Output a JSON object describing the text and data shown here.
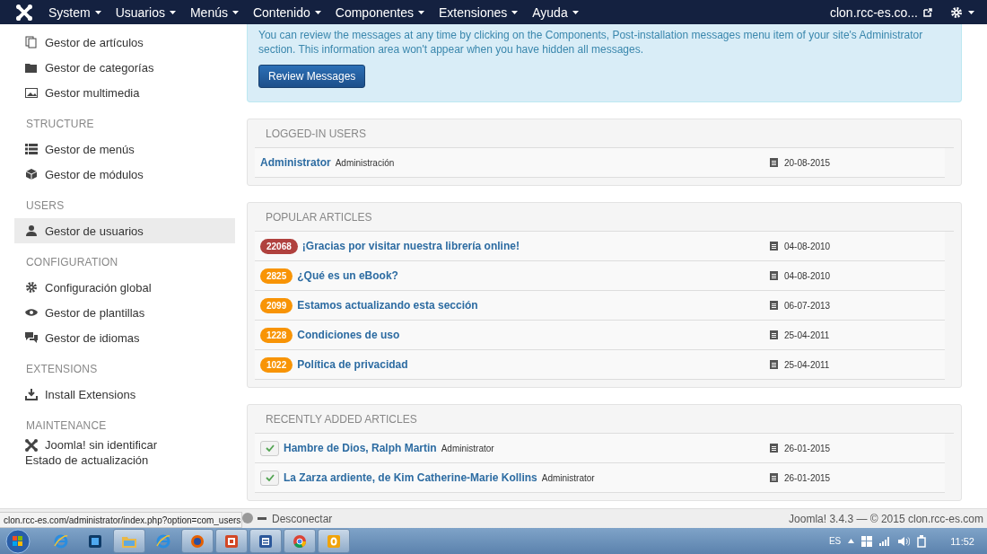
{
  "navbar": {
    "menus": [
      "System",
      "Usuarios",
      "Menús",
      "Contenido",
      "Componentes",
      "Extensiones",
      "Ayuda"
    ],
    "site": "clon.rcc-es.co..."
  },
  "sidebar": {
    "sections": [
      {
        "items": [
          {
            "label": "Gestor de artículos",
            "kind": "copy",
            "selected": false
          },
          {
            "label": "Gestor de categorías",
            "kind": "folder",
            "selected": false
          },
          {
            "label": "Gestor multimedia",
            "kind": "image",
            "selected": false
          }
        ]
      },
      {
        "heading": "STRUCTURE",
        "items": [
          {
            "label": "Gestor de menús",
            "kind": "list",
            "selected": false
          },
          {
            "label": "Gestor de módulos",
            "kind": "cube",
            "selected": false
          }
        ]
      },
      {
        "heading": "USERS",
        "items": [
          {
            "label": "Gestor de usuarios",
            "kind": "user",
            "selected": true
          }
        ]
      },
      {
        "heading": "CONFIGURATION",
        "items": [
          {
            "label": "Configuración global",
            "kind": "gear",
            "selected": false
          },
          {
            "label": "Gestor de plantillas",
            "kind": "eye",
            "selected": false
          },
          {
            "label": "Gestor de idiomas",
            "kind": "chat",
            "selected": false
          }
        ]
      },
      {
        "heading": "EXTENSIONS",
        "items": [
          {
            "label": "Install Extensions",
            "kind": "download",
            "selected": false
          }
        ]
      },
      {
        "heading": "MAINTENANCE",
        "items": [
          {
            "label": "Joomla! sin identificar",
            "sublabel": "Estado de actualización",
            "kind": "joomla",
            "selected": false
          }
        ]
      }
    ]
  },
  "message": {
    "text": "You can review the messages at any time by clicking on the Components, Post-installation messages menu item of your site's Administrator section. This information area won't appear when you have hidden all messages.",
    "button": "Review Messages"
  },
  "logged_in_users": {
    "title": "LOGGED-IN USERS",
    "rows": [
      {
        "name": "Administrator",
        "client": "Administración",
        "date": "20-08-2015"
      }
    ]
  },
  "popular_articles": {
    "title": "POPULAR ARTICLES",
    "rows": [
      {
        "hits": "22068",
        "color": "#b0413e",
        "title": "¡Gracias por visitar nuestra librería online!",
        "date": "04-08-2010"
      },
      {
        "hits": "2825",
        "color": "#f89406",
        "title": "¿Qué es un eBook?",
        "date": "04-08-2010"
      },
      {
        "hits": "2099",
        "color": "#f89406",
        "title": "Estamos actualizando esta sección",
        "date": "06-07-2013"
      },
      {
        "hits": "1228",
        "color": "#f89406",
        "title": "Condiciones de uso",
        "date": "25-04-2011"
      },
      {
        "hits": "1022",
        "color": "#f89406",
        "title": "Política de privacidad",
        "date": "25-04-2011"
      }
    ]
  },
  "recent_articles": {
    "title": "RECENTLY ADDED ARTICLES",
    "rows": [
      {
        "published": true,
        "title": "Hambre de Dios, Ralph Martin",
        "author": "Administrator",
        "date": "26-01-2015"
      },
      {
        "published": true,
        "title": "La Zarza ardiente, de Kim Catherine-Marie Kollins",
        "author": "Administrator",
        "date": "26-01-2015"
      }
    ]
  },
  "status_bar": {
    "logout": "Desconectar",
    "version": "Joomla! 3.4.3 — © 2015 clon.rcc-es.com"
  },
  "link_preview": "clon.rcc-es.com/administrator/index.php?option=com_users",
  "taskbar": {
    "apps": [
      {
        "kind": "ie",
        "active": false
      },
      {
        "kind": "ps",
        "active": false
      },
      {
        "kind": "explorer",
        "active": true
      },
      {
        "kind": "ie",
        "active": false
      },
      {
        "kind": "firefox",
        "active": true
      },
      {
        "kind": "powerpoint",
        "active": true
      },
      {
        "kind": "word",
        "active": true
      },
      {
        "kind": "chrome",
        "active": true
      },
      {
        "kind": "outlook",
        "active": true
      }
    ],
    "language": "ES",
    "clock": "11:52"
  }
}
